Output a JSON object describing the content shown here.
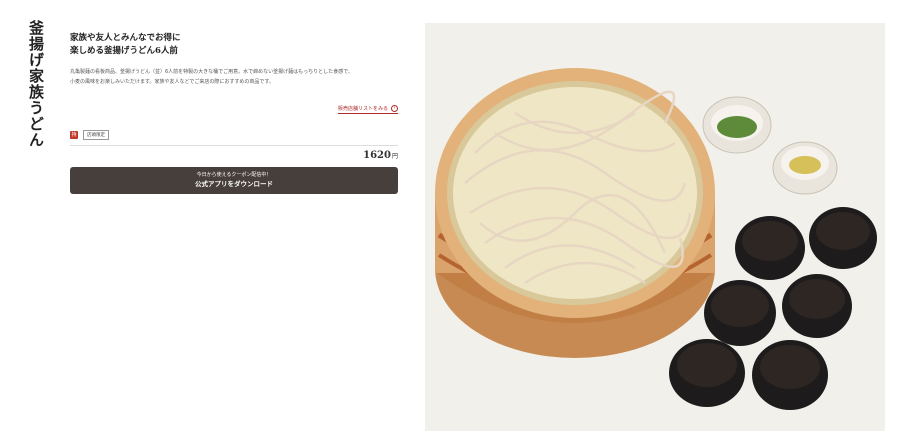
{
  "product": {
    "title": "釜揚げ家族うどん",
    "headline_1": "家族や友人とみんなでお得に",
    "headline_2": "楽しめる釜揚げうどん6人前",
    "description_1": "丸亀製麺の看板商品、釜揚げうどん（並）6人前を特製の大きな桶でご用意。水で締めない釜揚げ麺はもっちりとした食感で、",
    "description_2": "小麦の風味をお楽しみいただけます。家族や友人などでご来店の際におすすめの商品です。",
    "store_link_label": "販売店舗リストをみる",
    "badge_icon_label": "持",
    "tag_label": "店頭限定",
    "price": "1620",
    "price_unit": "円"
  },
  "cta": {
    "sub_label": "今日から使えるクーポン配信中！",
    "main_label": "公式アプリをダウンロード"
  },
  "colors": {
    "cta_bg": "#463f3b",
    "link": "#b02b2b",
    "badge": "#c0392b"
  },
  "image": {
    "icon": "udon-family-bucket-photo"
  }
}
